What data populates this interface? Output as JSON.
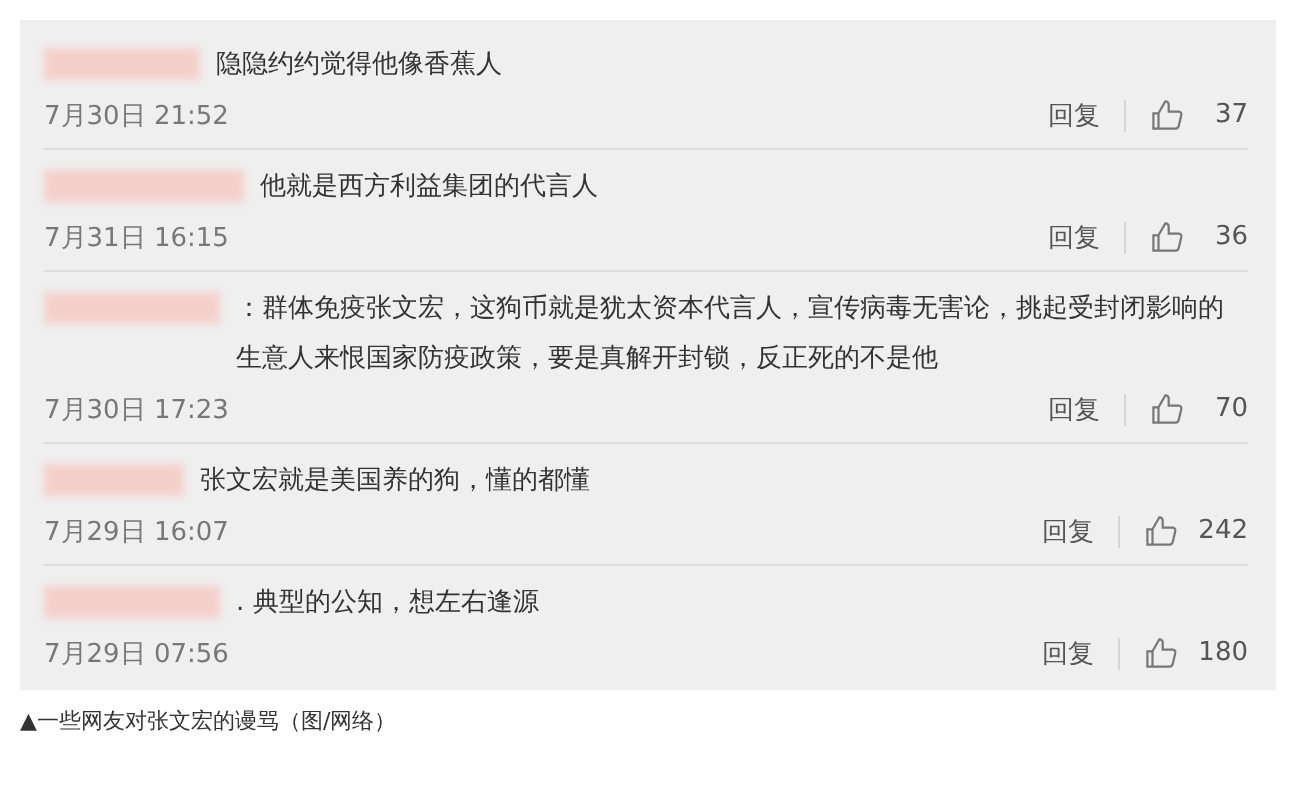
{
  "comments": [
    {
      "text": "隐隐约约觉得他像香蕉人",
      "time": "7月30日 21:52",
      "reply": "回复",
      "likes": "37"
    },
    {
      "text": "他就是西方利益集团的代言人",
      "time": "7月31日 16:15",
      "reply": "回复",
      "likes": "36"
    },
    {
      "text": "：群体免疫张文宏，这狗币就是犹太资本代言人，宣传病毒无害论，挑起受封闭影响的生意人来恨国家防疫政策，要是真解开封锁，反正死的不是他",
      "time": "7月30日 17:23",
      "reply": "回复",
      "likes": "70"
    },
    {
      "text": "张文宏就是美国养的狗，懂的都懂",
      "time": "7月29日 16:07",
      "reply": "回复",
      "likes": "242"
    },
    {
      "text": ". 典型的公知，想左右逢源",
      "time": "7月29日 07:56",
      "reply": "回复",
      "likes": "180"
    }
  ],
  "caption": "▲一些网友对张文宏的谩骂（图/网络）"
}
